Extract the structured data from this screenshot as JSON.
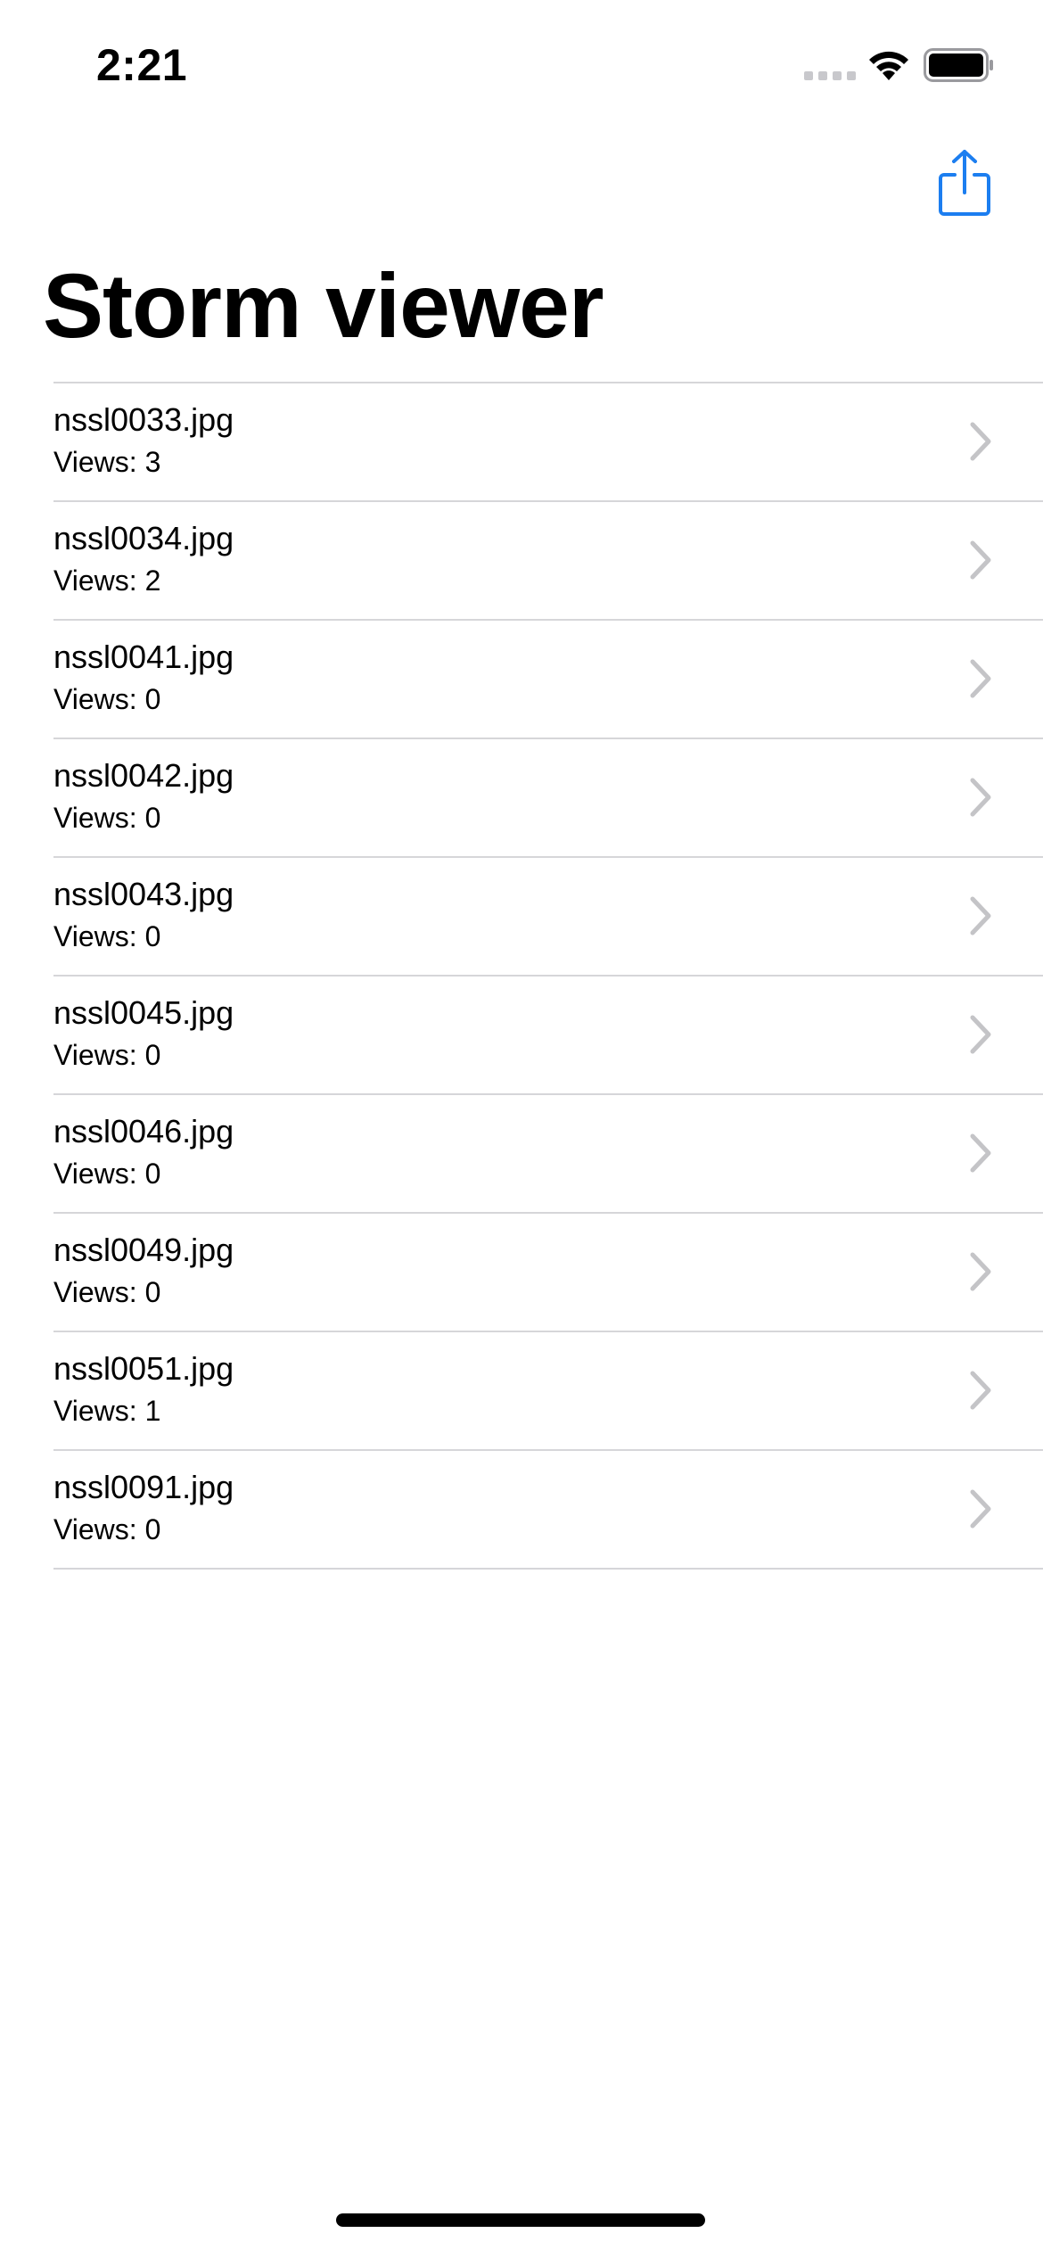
{
  "status_bar": {
    "time": "2:21"
  },
  "nav": {
    "title": "Storm viewer",
    "share_icon": "share-icon"
  },
  "colors": {
    "accent": "#1c7ef0",
    "separator": "#d6d6d9",
    "chevron": "#c4c4c7"
  },
  "items": [
    {
      "title": "nssl0033.jpg",
      "subtitle": "Views: 3"
    },
    {
      "title": "nssl0034.jpg",
      "subtitle": "Views: 2"
    },
    {
      "title": "nssl0041.jpg",
      "subtitle": "Views: 0"
    },
    {
      "title": "nssl0042.jpg",
      "subtitle": "Views: 0"
    },
    {
      "title": "nssl0043.jpg",
      "subtitle": "Views: 0"
    },
    {
      "title": "nssl0045.jpg",
      "subtitle": "Views: 0"
    },
    {
      "title": "nssl0046.jpg",
      "subtitle": "Views: 0"
    },
    {
      "title": "nssl0049.jpg",
      "subtitle": "Views: 0"
    },
    {
      "title": "nssl0051.jpg",
      "subtitle": "Views: 1"
    },
    {
      "title": "nssl0091.jpg",
      "subtitle": "Views: 0"
    }
  ]
}
